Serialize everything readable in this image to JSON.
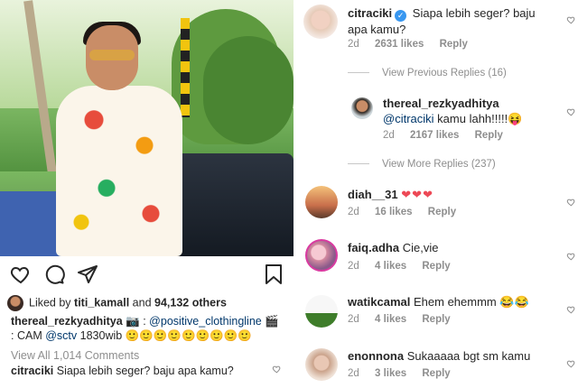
{
  "post": {
    "liked_prefix": "Liked by",
    "liked_user": "titi_kamall",
    "liked_and": "and",
    "liked_count": "94,132 others",
    "caption_user": "thereal_rezkyadhitya",
    "caption_camera": "📷 :",
    "caption_mention1": "@positive_clothingline",
    "caption_clapper": "🎬 :",
    "caption_cam": "CAM",
    "caption_mention2": "@sctv",
    "caption_time": "1830wib",
    "caption_emojis": "🙂🙂🙂🙂🙂🙂🙂🙂🙂",
    "view_all": "View All 1,014 Comments",
    "last_comment_user": "citraciki",
    "last_comment_text": "Siapa lebih seger? baju apa kamu?"
  },
  "comments": {
    "c1": {
      "user": "citraciki",
      "text": "Siapa lebih seger? baju apa kamu?",
      "time": "2d",
      "likes": "2631 likes",
      "reply": "Reply"
    },
    "view_prev": "View Previous Replies (16)",
    "c2": {
      "user": "thereal_rezkyadhitya",
      "mention": "@citraciki",
      "text": "kamu lahh!!!!!😝",
      "time": "2d",
      "likes": "2167 likes",
      "reply": "Reply"
    },
    "view_more": "View More Replies (237)",
    "c3": {
      "user": "diah__31",
      "text": "❤❤❤",
      "time": "2d",
      "likes": "16 likes",
      "reply": "Reply"
    },
    "c4": {
      "user": "faiq.adha",
      "text": "Cie,vie",
      "time": "2d",
      "likes": "4 likes",
      "reply": "Reply"
    },
    "c5": {
      "user": "watikcamal",
      "text": "Ehem ehemmm 😂😂",
      "time": "2d",
      "likes": "4 likes",
      "reply": "Reply"
    },
    "c6": {
      "user": "enonnona",
      "text": "Sukaaaaa bgt sm kamu",
      "time": "2d",
      "likes": "3 likes",
      "reply": "Reply"
    }
  },
  "colors": {
    "blue_link": "#00376b",
    "verified": "#3897f0",
    "heart_red": "#ed4956",
    "gray": "#8e8e8e"
  },
  "icons": [
    "heart-icon",
    "comment-icon",
    "share-icon",
    "bookmark-icon",
    "camera-emoji",
    "clapper-emoji",
    "verified-badge-icon"
  ]
}
